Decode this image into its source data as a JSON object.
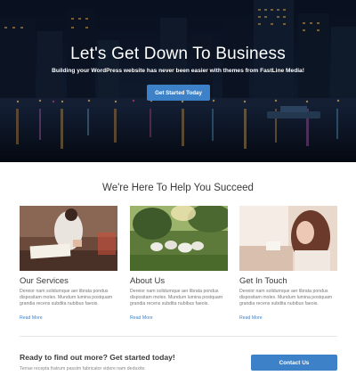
{
  "hero": {
    "title": "Let's Get Down To Business",
    "subtitle": "Building your WordPress website has never been easier with themes from FastLine Media!",
    "button_label": "Get Started Today",
    "background_image": "night-city-skyline-waterfront"
  },
  "services": {
    "heading": "We're Here To Help You Succeed",
    "cards": [
      {
        "image": "person-writing-notebook",
        "title": "Our Services",
        "text": "Dereior nam solidumque aer librata pondus dispositam moles. Mundum lumina postquam grandia recens subdita nubibus faeois.",
        "link": "Read More"
      },
      {
        "image": "sheep-grazing-field",
        "title": "About Us",
        "text": "Dereior nam solidumque aer librata pondus dispositam moles. Mundum lumina postquam grandia recens subdita nubibus faeois.",
        "link": "Read More"
      },
      {
        "image": "woman-by-window",
        "title": "Get In Touch",
        "text": "Dereior nam solidumque aer librata pondus dispositam moles. Mundum lumina postquam grandia recens subdita nubibus faeois.",
        "link": "Read More"
      }
    ]
  },
  "cta": {
    "title": "Ready to find out more? Get started today!",
    "text": "Terrae recepta fratrum passim fabricator videre nam deduxite.",
    "button_label": "Contact Us"
  },
  "colors": {
    "accent": "#3d82c8",
    "heading": "#3a3a3a",
    "body_text": "#777777"
  }
}
